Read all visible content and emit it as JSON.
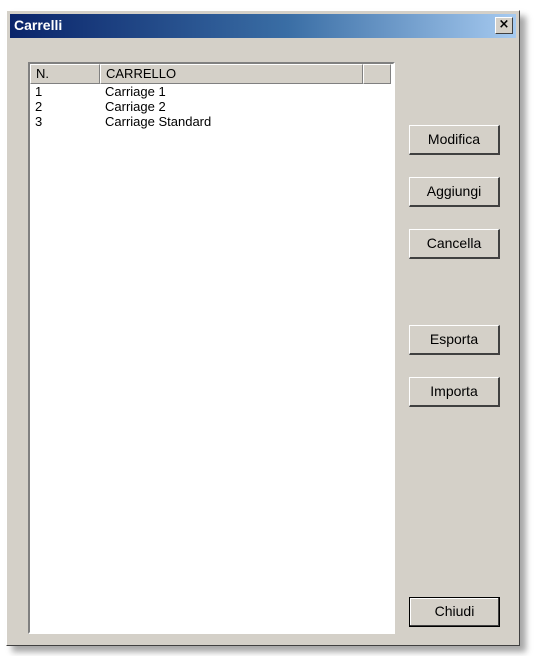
{
  "window": {
    "title": "Carrelli",
    "close_label": "×"
  },
  "list": {
    "columns": [
      "N.",
      "CARRELLO"
    ],
    "rows": [
      {
        "n": "1",
        "name": "Carriage 1"
      },
      {
        "n": "2",
        "name": "Carriage 2"
      },
      {
        "n": "3",
        "name": "Carriage Standard"
      }
    ]
  },
  "buttons": {
    "modifica": "Modifica",
    "aggiungi": "Aggiungi",
    "cancella": "Cancella",
    "esporta": "Esporta",
    "importa": "Importa",
    "chiudi": "Chiudi"
  },
  "colors": {
    "face": "#d4d0c8",
    "title_start": "#0a246a",
    "title_end": "#a6caf0"
  }
}
